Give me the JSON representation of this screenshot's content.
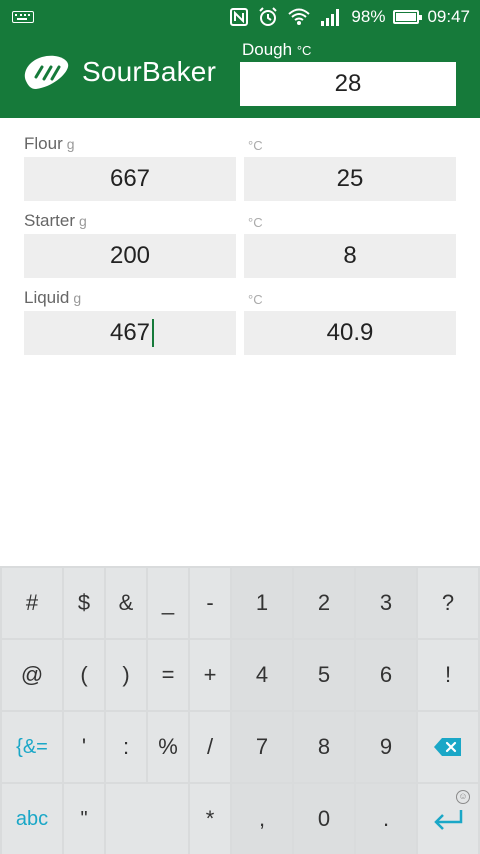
{
  "status": {
    "battery": "98%",
    "battery_level": 0.98,
    "time": "09:47",
    "icons": [
      "keyboard-icon",
      "nfc-icon",
      "alarm-icon",
      "wifi-icon",
      "signal-icon",
      "battery-icon"
    ]
  },
  "header": {
    "app_title": "SourBaker",
    "dough_label": "Dough",
    "dough_unit": "°C",
    "dough_value": "28",
    "brand_color": "#167a3a"
  },
  "rows": [
    {
      "label": "Flour",
      "unit": "g",
      "value": "667",
      "temp_unit": "°C",
      "temp": "25"
    },
    {
      "label": "Starter",
      "unit": "g",
      "value": "200",
      "temp_unit": "°C",
      "temp": "8"
    },
    {
      "label": "Liquid",
      "unit": "g",
      "value": "467",
      "temp_unit": "°C",
      "temp": "40.9"
    }
  ],
  "keyboard": {
    "accent_color": "#1aa7c7",
    "rows": [
      [
        "#",
        "$",
        "&",
        "_",
        "-",
        "1",
        "2",
        "3",
        "?"
      ],
      [
        "@",
        "(",
        ")",
        "=",
        "+",
        "4",
        "5",
        "6",
        "!"
      ],
      [
        "{&=",
        "'",
        ":",
        "%",
        "/",
        "7",
        "8",
        "9",
        "⌫"
      ],
      [
        "abc",
        "\"",
        "",
        "*",
        ",",
        "0",
        ".",
        "↵"
      ]
    ]
  }
}
